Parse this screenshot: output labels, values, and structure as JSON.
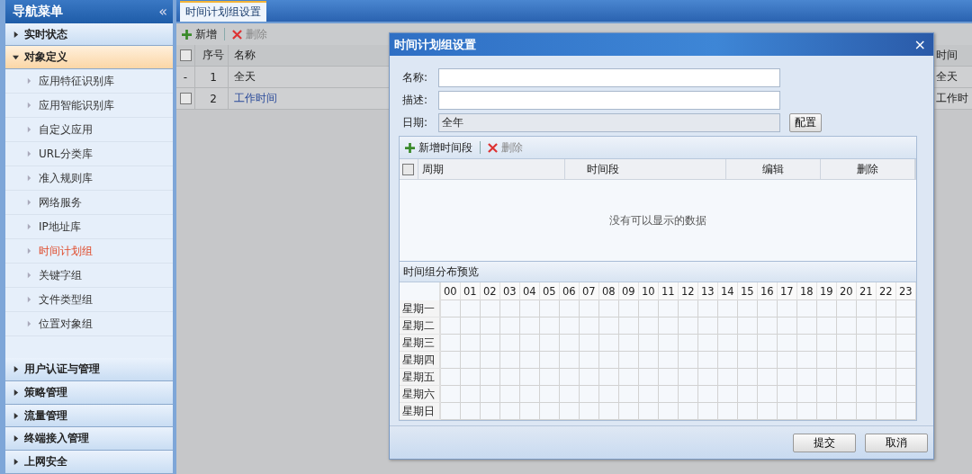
{
  "sidebar": {
    "title": "导航菜单",
    "collapse": "«",
    "groups": [
      {
        "label": "实时状态",
        "expanded": false
      },
      {
        "label": "对象定义",
        "expanded": true,
        "children": [
          {
            "label": "应用特征识别库",
            "selected": false
          },
          {
            "label": "应用智能识别库",
            "selected": false
          },
          {
            "label": "自定义应用",
            "selected": false
          },
          {
            "label": "URL分类库",
            "selected": false
          },
          {
            "label": "准入规则库",
            "selected": false
          },
          {
            "label": "网络服务",
            "selected": false
          },
          {
            "label": "IP地址库",
            "selected": false
          },
          {
            "label": "时间计划组",
            "selected": true
          },
          {
            "label": "关键字组",
            "selected": false
          },
          {
            "label": "文件类型组",
            "selected": false
          },
          {
            "label": "位置对象组",
            "selected": false
          }
        ]
      },
      {
        "label": "用户认证与管理",
        "expanded": false
      },
      {
        "label": "策略管理",
        "expanded": false
      },
      {
        "label": "流量管理",
        "expanded": false
      },
      {
        "label": "终端接入管理",
        "expanded": false
      },
      {
        "label": "上网安全",
        "expanded": false
      }
    ]
  },
  "tabs": [
    {
      "label": "时间计划组设置",
      "selected": true
    }
  ],
  "toolbar": {
    "add": "新增",
    "delete": "删除"
  },
  "table": {
    "columns": [
      "序号",
      "名称",
      "时间"
    ],
    "header_checked": false,
    "rows": [
      {
        "kind": "dash",
        "dash": "-",
        "index": "1",
        "name": "全天",
        "column_3": "全天"
      },
      {
        "kind": "checkbox",
        "checked": false,
        "index": "2",
        "name": "工作时间",
        "column_3": "工作时"
      }
    ]
  },
  "dialog": {
    "title": "时间计划组设置",
    "close": "×",
    "fields": [
      {
        "label": "名称:",
        "disabled": false
      },
      {
        "label": "描述:",
        "disabled": false
      },
      {
        "label": "日期:",
        "value": "全年",
        "disabled": true
      }
    ],
    "config_button": "配置",
    "toolbar": {
      "add": "新增时间段",
      "delete": "删除"
    },
    "columns": [
      "周期",
      "时间段",
      "编辑",
      "删除"
    ],
    "header_checked": false,
    "empty_text": "没有可以显示的数据",
    "preview": {
      "title": "时间组分布预览",
      "hours": [
        "00",
        "01",
        "02",
        "03",
        "04",
        "05",
        "06",
        "07",
        "08",
        "09",
        "10",
        "11",
        "12",
        "13",
        "14",
        "15",
        "16",
        "17",
        "18",
        "19",
        "20",
        "21",
        "22",
        "23"
      ],
      "days": [
        "星期一",
        "星期二",
        "星期三",
        "星期四",
        "星期五",
        "星期六",
        "星期日"
      ]
    },
    "buttons": [
      "提交",
      "取消"
    ]
  }
}
